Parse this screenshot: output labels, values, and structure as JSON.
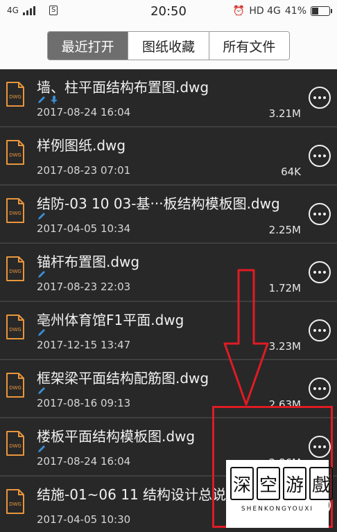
{
  "status_bar": {
    "network": "4G",
    "time": "20:50",
    "right_network": "HD 4G",
    "battery_percent": "41%",
    "battery_level": 0.41,
    "sim_label": "S"
  },
  "tabs": [
    {
      "label": "最近打开",
      "active": true
    },
    {
      "label": "图纸收藏",
      "active": false
    },
    {
      "label": "所有文件",
      "active": false
    }
  ],
  "files": [
    {
      "name": "墙、柱平面结构布置图.dwg",
      "date": "2017-08-24 16:04",
      "size": "3.21M",
      "tags": [
        "pen",
        "mic"
      ]
    },
    {
      "name": "样例图纸.dwg",
      "date": "2017-08-23 07:01",
      "size": "64K",
      "tags": []
    },
    {
      "name": "结防-03 10 03-基···板结构模板图.dwg",
      "date": "2017-04-05 10:34",
      "size": "2.25M",
      "tags": [
        "pen"
      ]
    },
    {
      "name": "锚杆布置图.dwg",
      "date": "2017-08-23 22:03",
      "size": "1.72M",
      "tags": [
        "pen"
      ]
    },
    {
      "name": "亳州体育馆F1平面.dwg",
      "date": "2017-12-15 13:47",
      "size": "3.23M",
      "tags": [
        "pen"
      ]
    },
    {
      "name": "框架梁平面结构配筋图.dwg",
      "date": "2017-08-16 09:13",
      "size": "2.63M",
      "tags": [
        "pen"
      ]
    },
    {
      "name": "楼板平面结构模板图.dwg",
      "date": "2017-08-24 16:04",
      "size": "2.86M",
      "tags": [
        "pen"
      ]
    },
    {
      "name": "结施-01~06 11 结构设计总说",
      "date": "2017-04-05 10:30",
      "size": "",
      "tags": []
    }
  ],
  "file_icon_label": "DWG",
  "watermark": {
    "glyphs": [
      "深",
      "空",
      "游",
      "戲"
    ],
    "subtitle": "SHENKONGYOUXI"
  },
  "colors": {
    "list_bg": "#282828",
    "row_divider": "#3f3f3f",
    "active_tab": "#6e6e6e",
    "file_icon": "#e8963c",
    "tag_icon": "#3a8fd8",
    "annotation_red": "#e01b24"
  }
}
